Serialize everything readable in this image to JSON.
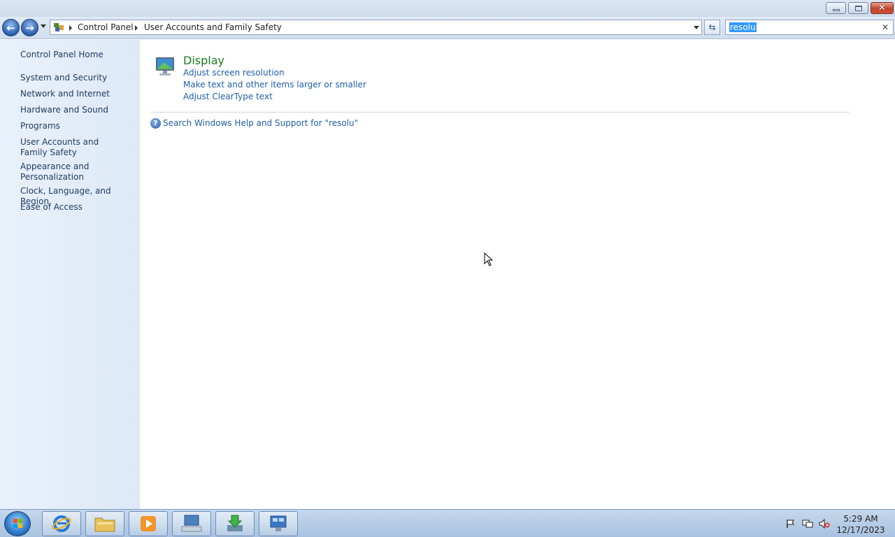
{
  "window": {
    "min_icon": "minimize-icon",
    "max_icon": "restore-icon",
    "close_icon": "close-icon"
  },
  "nav": {
    "breadcrumb": [
      "Control Panel",
      "User Accounts and Family Safety"
    ],
    "search_value": "resolu",
    "clear_glyph": "✕"
  },
  "sidebar": {
    "items": [
      {
        "label": "Control Panel Home"
      },
      {
        "label": "System and Security"
      },
      {
        "label": "Network and Internet"
      },
      {
        "label": "Hardware and Sound"
      },
      {
        "label": "Programs"
      },
      {
        "label": "User Accounts and Family Safety"
      },
      {
        "label": "Appearance and Personalization"
      },
      {
        "label": "Clock, Language, and Region"
      },
      {
        "label": "Ease of Access"
      }
    ]
  },
  "results": {
    "category": "Display",
    "tasks": [
      "Adjust screen resolution",
      "Make text and other items larger or smaller",
      "Adjust ClearType text"
    ],
    "help_link": "Search Windows Help and Support for \"resolu\""
  },
  "taskbar": {
    "time": "5:29 AM",
    "date": "12/17/2023"
  }
}
